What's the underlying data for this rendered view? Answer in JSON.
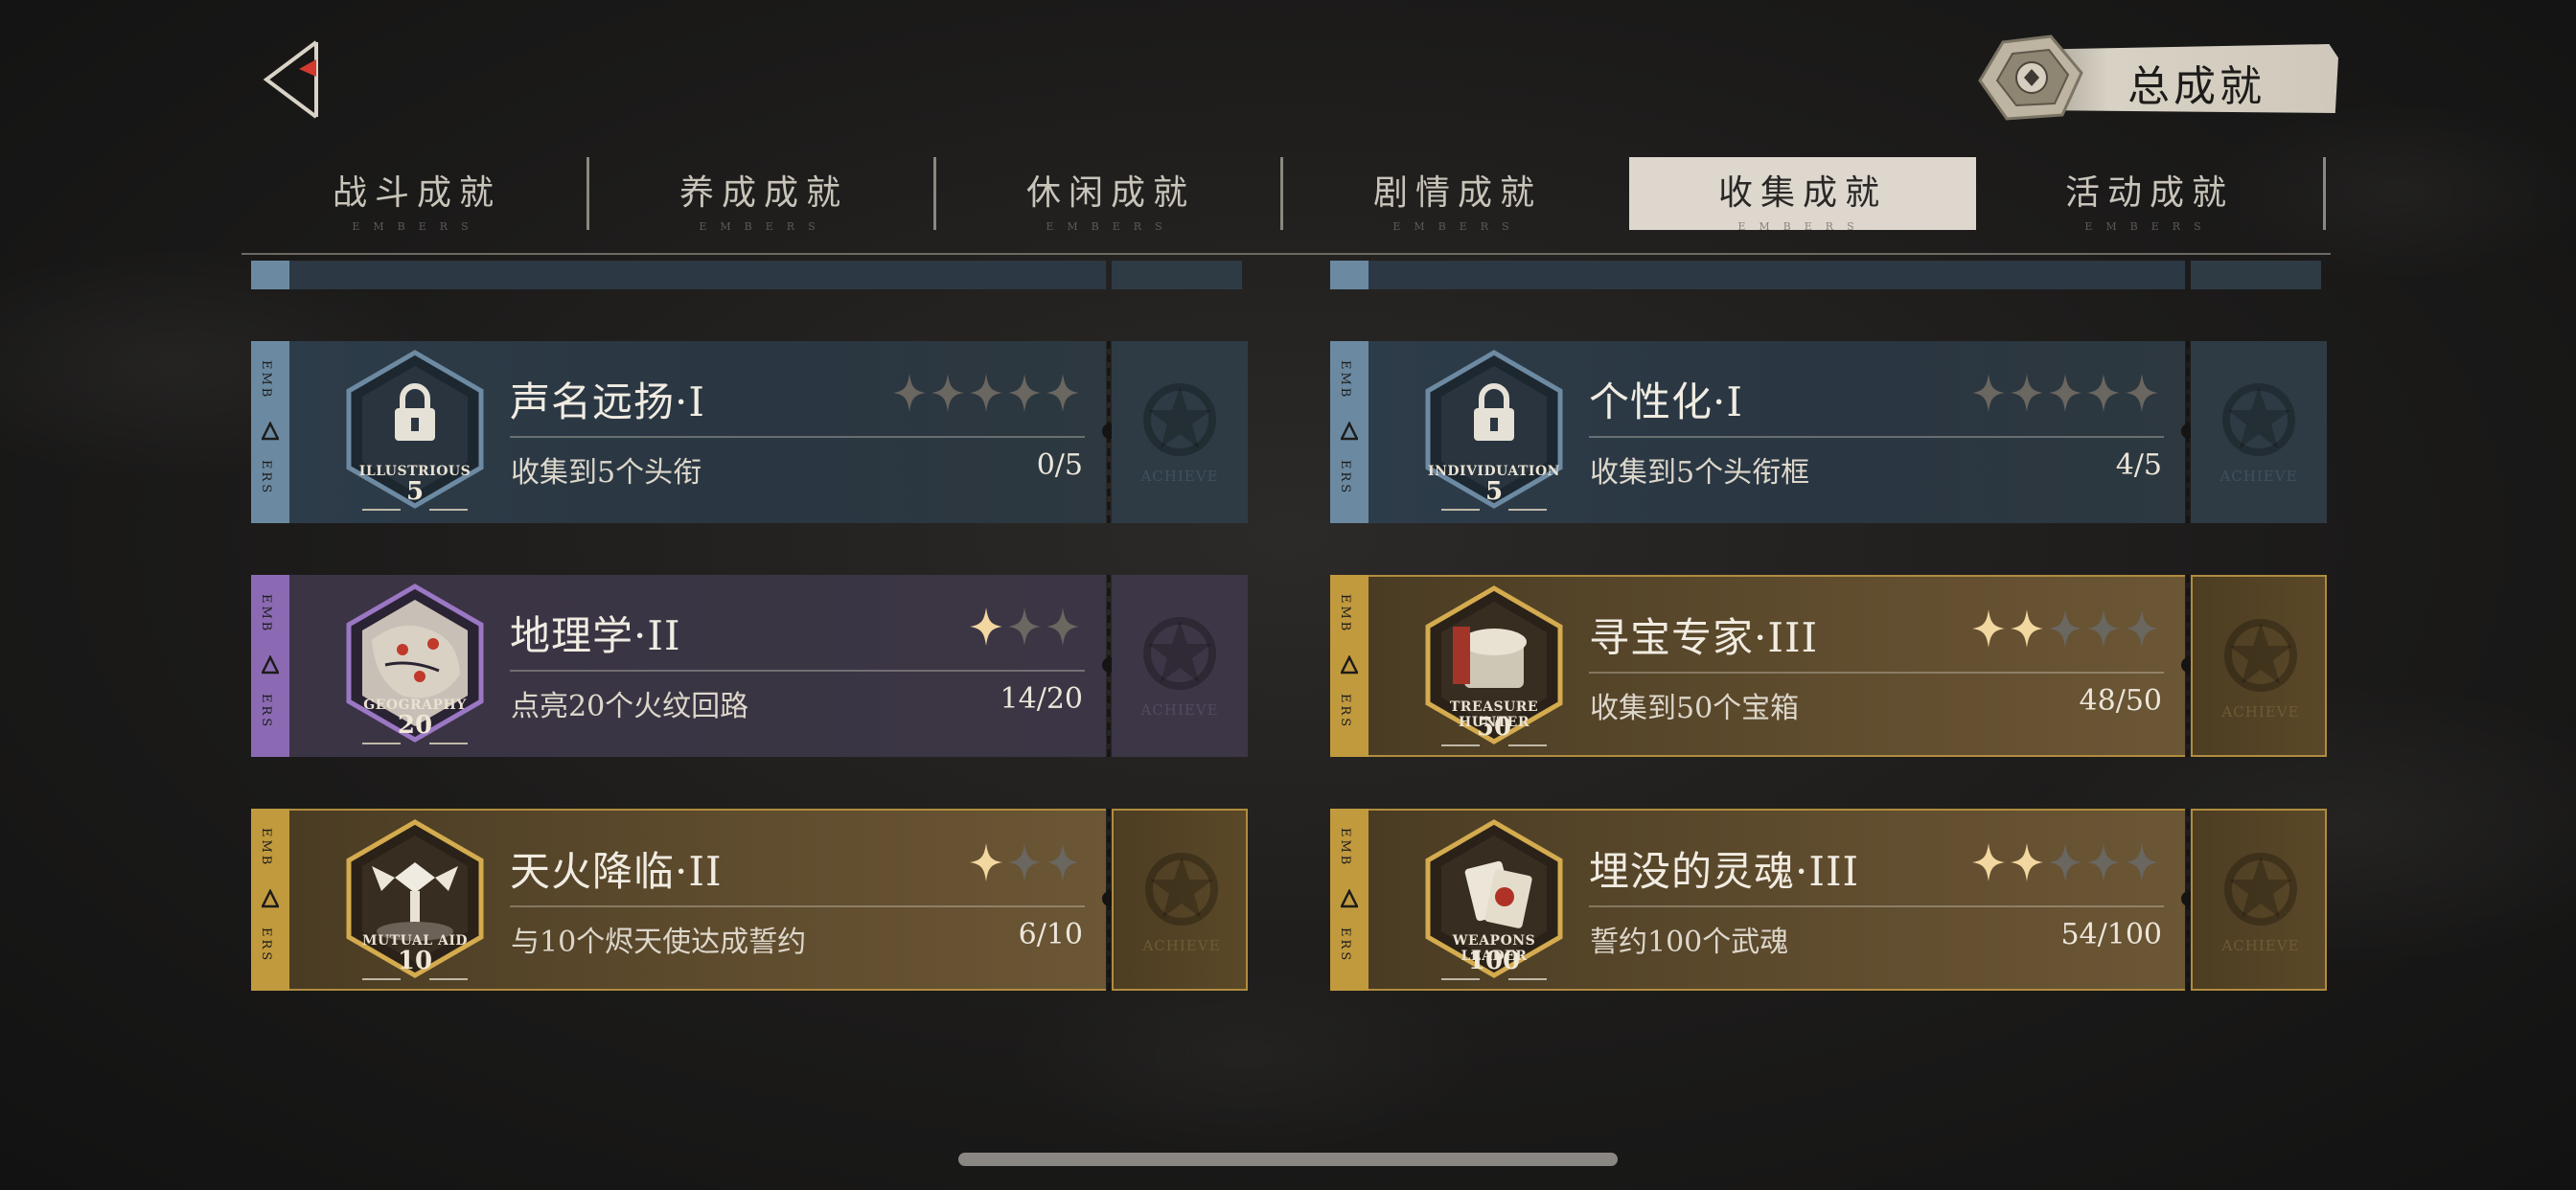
{
  "total_label": "总成就",
  "tabs": [
    {
      "label": "战斗成就",
      "sub": "EMBERS",
      "active": false
    },
    {
      "label": "养成成就",
      "sub": "EMBERS",
      "active": false
    },
    {
      "label": "休闲成就",
      "sub": "EMBERS",
      "active": false
    },
    {
      "label": "剧情成就",
      "sub": "EMBERS",
      "active": false
    },
    {
      "label": "收集成就",
      "sub": "EMBERS",
      "active": true
    },
    {
      "label": "活动成就",
      "sub": "EMBERS",
      "active": false
    }
  ],
  "strip_top": "EMB",
  "strip_bottom": "ERS",
  "stub_label": "ACHIEVE",
  "cards": [
    {
      "title": "声名远扬·I",
      "desc": "收集到5个头衔",
      "progress": "0/5",
      "stars_lit": 0,
      "stars_total": 5,
      "badge_text": "ILLUSTRIOUS",
      "badge_num": "5",
      "theme": "blue"
    },
    {
      "title": "个性化·I",
      "desc": "收集到5个头衔框",
      "progress": "4/5",
      "stars_lit": 0,
      "stars_total": 5,
      "badge_text": "INDIVIDUATION",
      "badge_num": "5",
      "theme": "blue"
    },
    {
      "title": "地理学·II",
      "desc": "点亮20个火纹回路",
      "progress": "14/20",
      "stars_lit": 1,
      "stars_total": 3,
      "badge_text": "GEOGRAPHY",
      "badge_num": "20",
      "theme": "purple"
    },
    {
      "title": "寻宝专家·III",
      "desc": "收集到50个宝箱",
      "progress": "48/50",
      "stars_lit": 2,
      "stars_total": 5,
      "badge_text": "TREASURE HUNTER",
      "badge_num": "50",
      "theme": "gold"
    },
    {
      "title": "天火降临·II",
      "desc": "与10个烬天使达成誓约",
      "progress": "6/10",
      "stars_lit": 1,
      "stars_total": 3,
      "badge_text": "MUTUAL AID",
      "badge_num": "10",
      "theme": "gold"
    },
    {
      "title": "埋没的灵魂·III",
      "desc": "誓约100个武魂",
      "progress": "54/100",
      "stars_lit": 2,
      "stars_total": 5,
      "badge_text": "WEAPONS LEADER",
      "badge_num": "100",
      "theme": "gold"
    }
  ],
  "colors": {
    "accent_red": "#d23a2f",
    "star_lit": "#f2d7a0",
    "star_dim": "#6a6660"
  }
}
